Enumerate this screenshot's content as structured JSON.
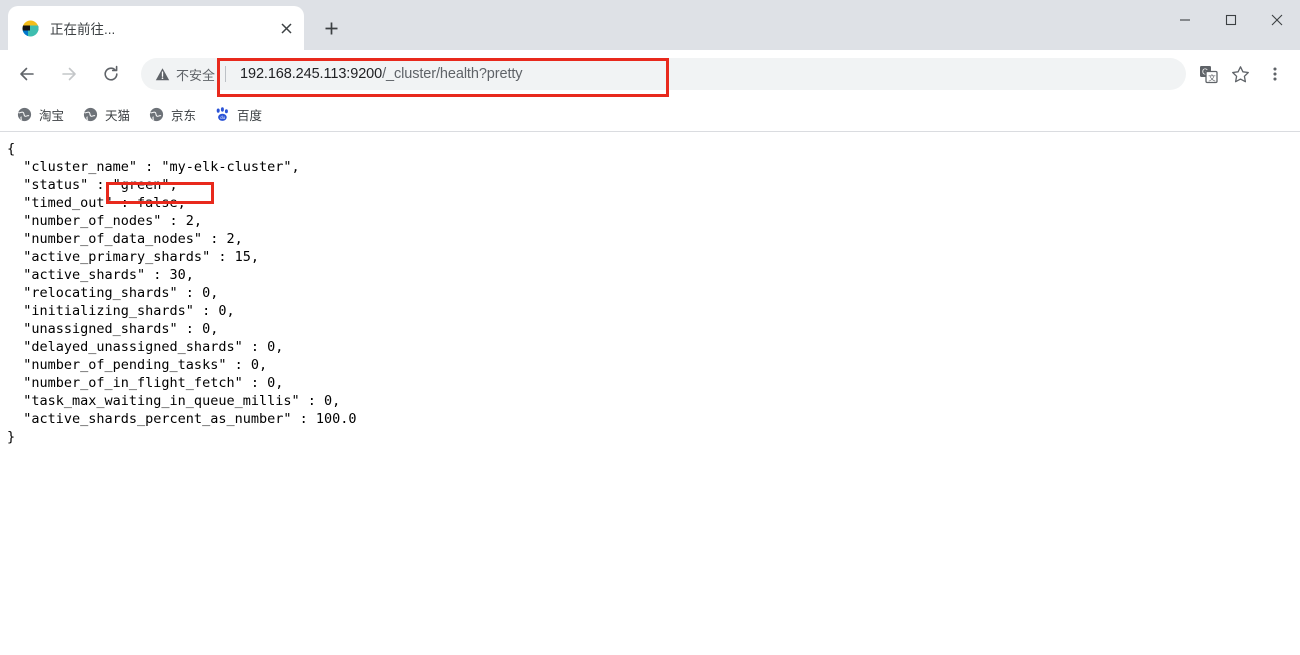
{
  "window": {
    "controls": [
      {
        "name": "minimize",
        "glyph": "minimize-icon"
      },
      {
        "name": "maximize",
        "glyph": "maximize-icon"
      },
      {
        "name": "close",
        "glyph": "close-icon"
      }
    ]
  },
  "tabstrip": {
    "tabs": [
      {
        "title": "正在前往...",
        "favicon": "elasticsearch-favicon",
        "close_label": "×"
      }
    ],
    "new_tab_label": "+"
  },
  "toolbar": {
    "back_label": "back-arrow-icon",
    "forward_label": "forward-arrow-icon",
    "reload_label": "reload-icon",
    "security": {
      "icon": "warning-triangle-icon",
      "label": "不安全"
    },
    "url": {
      "host": "192.168.245.113:9200",
      "path": "/_cluster/health?pretty",
      "full": "192.168.245.113:9200/_cluster/health?pretty"
    },
    "translate_icon": "translate-icon",
    "bookmark_star_icon": "star-icon",
    "menu_icon": "three-dot-menu-icon"
  },
  "bookmarks": {
    "items": [
      {
        "label": "淘宝",
        "icon": "globe-icon"
      },
      {
        "label": "天猫",
        "icon": "globe-icon"
      },
      {
        "label": "京东",
        "icon": "globe-icon"
      },
      {
        "label": "百度",
        "icon": "baidu-paw-icon"
      }
    ]
  },
  "page": {
    "content_type": "json",
    "json_text": "{\n  \"cluster_name\" : \"my-elk-cluster\",\n  \"status\" : \"green\",\n  \"timed_out\" : false,\n  \"number_of_nodes\" : 2,\n  \"number_of_data_nodes\" : 2,\n  \"active_primary_shards\" : 15,\n  \"active_shards\" : 30,\n  \"relocating_shards\" : 0,\n  \"initializing_shards\" : 0,\n  \"unassigned_shards\" : 0,\n  \"delayed_unassigned_shards\" : 0,\n  \"number_of_pending_tasks\" : 0,\n  \"number_of_in_flight_fetch\" : 0,\n  \"task_max_waiting_in_queue_millis\" : 0,\n  \"active_shards_percent_as_number\" : 100.0\n}",
    "json_fields": {
      "cluster_name": "my-elk-cluster",
      "status": "green",
      "timed_out": "false",
      "number_of_nodes": "2",
      "number_of_data_nodes": "2",
      "active_primary_shards": "15",
      "active_shards": "30",
      "relocating_shards": "0",
      "initializing_shards": "0",
      "unassigned_shards": "0",
      "delayed_unassigned_shards": "0",
      "number_of_pending_tasks": "0",
      "number_of_in_flight_fetch": "0",
      "task_max_waiting_in_queue_millis": "0",
      "active_shards_percent_as_number": "100.0"
    }
  },
  "annotations": {
    "highlight_color": "#e8291c",
    "boxes": [
      {
        "target": "url-text",
        "note": "address bar URL highlighted"
      },
      {
        "target": "status-value",
        "note": "cluster status value green highlighted"
      }
    ]
  }
}
